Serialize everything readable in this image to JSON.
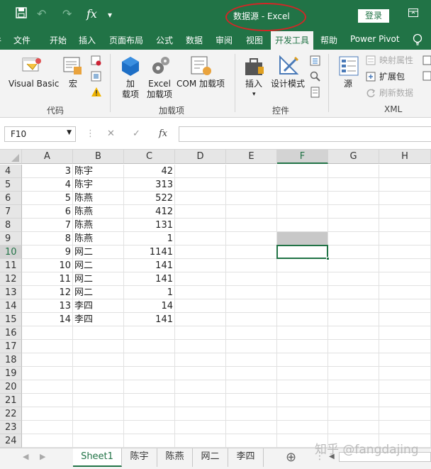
{
  "titlebar": {
    "save_icon": "save-icon",
    "undo_icon": "undo-icon",
    "redo_icon": "redo-icon",
    "fx_label": "fx",
    "qat_dropdown": "▾",
    "title": "数据源  -  Excel",
    "login_label": "登录",
    "accent": "#217346"
  },
  "tabs": [
    {
      "label": "件"
    },
    {
      "label": "文件"
    },
    {
      "label": "开始"
    },
    {
      "label": "插入"
    },
    {
      "label": "页面布局"
    },
    {
      "label": "公式"
    },
    {
      "label": "数据"
    },
    {
      "label": "审阅"
    },
    {
      "label": "视图"
    },
    {
      "label": "开发工具",
      "active": true
    },
    {
      "label": "帮助"
    },
    {
      "label": "Power Pivot"
    }
  ],
  "ribbon": {
    "visual_basic": "Visual Basic",
    "macro": "宏",
    "addins": "加\n载项",
    "excel_addins": "Excel\n加载项",
    "com_addins": "COM 加载项",
    "insert": "插入",
    "design_mode": "设计模式",
    "source": "源",
    "map_properties": "映射属性",
    "expansion_pack": "扩展包",
    "refresh_data": "刷新数据",
    "groups": {
      "code": "代码",
      "addins": "加载项",
      "controls": "控件",
      "xml": "XML"
    }
  },
  "formula_bar": {
    "name_box": "F10",
    "cancel": "✕",
    "enter": "✓",
    "fx": "fx",
    "value": ""
  },
  "columns": [
    "A",
    "B",
    "C",
    "D",
    "E",
    "F",
    "G",
    "H"
  ],
  "selected_column": "F",
  "rows": [
    {
      "n": "4",
      "a": "3",
      "b": "陈宇",
      "c": "42"
    },
    {
      "n": "5",
      "a": "4",
      "b": "陈宇",
      "c": "313"
    },
    {
      "n": "6",
      "a": "5",
      "b": "陈燕",
      "c": "522"
    },
    {
      "n": "7",
      "a": "6",
      "b": "陈燕",
      "c": "412"
    },
    {
      "n": "8",
      "a": "7",
      "b": "陈燕",
      "c": "131"
    },
    {
      "n": "9",
      "a": "8",
      "b": "陈燕",
      "c": "1"
    },
    {
      "n": "10",
      "a": "9",
      "b": "网二",
      "c": "1141"
    },
    {
      "n": "11",
      "a": "10",
      "b": "网二",
      "c": "141"
    },
    {
      "n": "12",
      "a": "11",
      "b": "网二",
      "c": "141"
    },
    {
      "n": "13",
      "a": "12",
      "b": "网二",
      "c": "1"
    },
    {
      "n": "14",
      "a": "13",
      "b": "李四",
      "c": "14"
    },
    {
      "n": "15",
      "a": "14",
      "b": "李四",
      "c": "141"
    },
    {
      "n": "16",
      "a": "",
      "b": "",
      "c": ""
    },
    {
      "n": "17",
      "a": "",
      "b": "",
      "c": ""
    },
    {
      "n": "18",
      "a": "",
      "b": "",
      "c": ""
    },
    {
      "n": "19",
      "a": "",
      "b": "",
      "c": ""
    },
    {
      "n": "20",
      "a": "",
      "b": "",
      "c": ""
    },
    {
      "n": "21",
      "a": "",
      "b": "",
      "c": ""
    },
    {
      "n": "22",
      "a": "",
      "b": "",
      "c": ""
    },
    {
      "n": "23",
      "a": "",
      "b": "",
      "c": ""
    },
    {
      "n": "24",
      "a": "",
      "b": "",
      "c": ""
    }
  ],
  "sheets": [
    {
      "label": "Sheet1",
      "active": true
    },
    {
      "label": "陈宇"
    },
    {
      "label": "陈燕"
    },
    {
      "label": "网二"
    },
    {
      "label": "李四"
    }
  ],
  "add_sheet": "⊕",
  "watermark": "知乎 @fangdajing"
}
